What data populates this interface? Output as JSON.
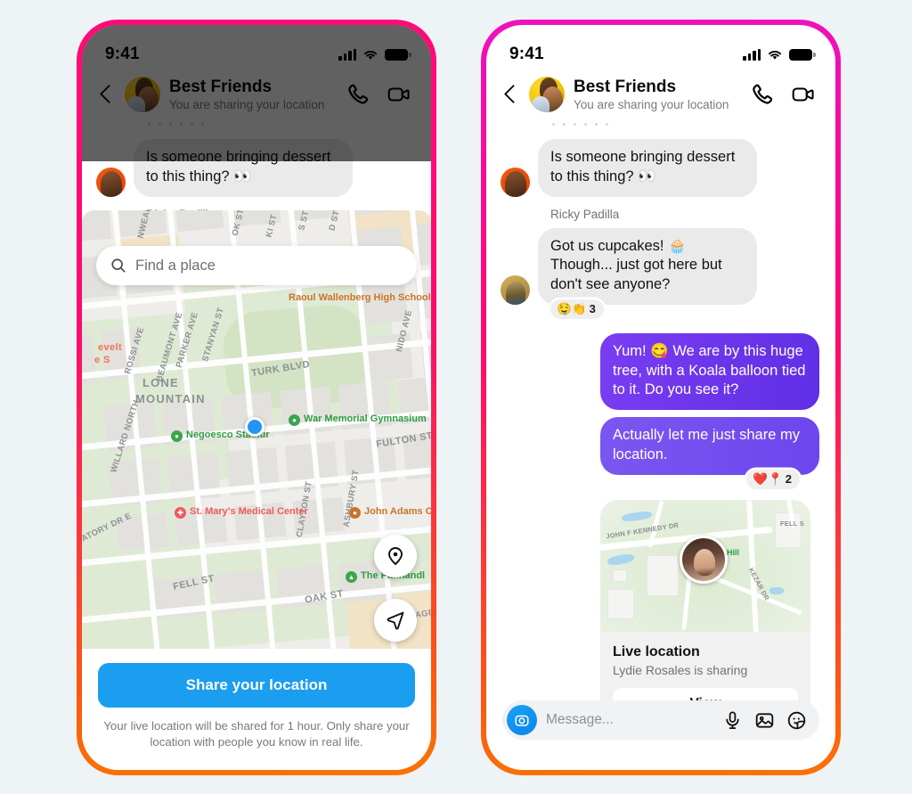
{
  "theme": {
    "background": "#eef3f6",
    "frame_gradient_top": "#ff0a78",
    "frame_gradient_bottom": "#f97306",
    "accent_blue": "#1b9df0",
    "bubble_purple": "#6b34ea",
    "bubble_grey": "#eaeaea"
  },
  "left_phone": {
    "status_bar": {
      "time": "9:41",
      "signal_icon": "cellular-bars-icon",
      "wifi_icon": "wifi-icon",
      "battery_icon": "battery-full-icon"
    },
    "header": {
      "back_icon": "back-chevron-icon",
      "avatar": "group-avatar",
      "title": "Best Friends",
      "subtitle": "You are sharing your location",
      "call_icon": "phone-icon",
      "video_icon": "video-camera-icon"
    },
    "messages": [
      {
        "sender": "",
        "text": "Is someone bringing dessert to this thing? 👀",
        "direction": "in",
        "avatar": "av-ricky"
      }
    ],
    "sender_label": "Ricky Padilla",
    "map": {
      "search_placeholder": "Find a place",
      "search_icon": "search-icon",
      "locate_icon": "location-pin-icon",
      "navigate_icon": "navigation-arrow-icon",
      "my_location_marker": "blue-dot-marker",
      "street_labels": [
        "NWEAL",
        "OK ST",
        "KI ST",
        "S ST",
        "D ST",
        "STANYAN ST",
        "BEAUMONT AVE",
        "PARKER AVE",
        "ROSSI AVE",
        "NIDO AVE",
        "TURK BLVD",
        "WILLARD NORTH",
        "FULTON ST",
        "CLAYTON ST",
        "ASHBURY ST",
        "FELL ST",
        "OAK ST",
        "NATORY DR E",
        "PAGE"
      ],
      "area_labels": [
        "LONE",
        "MOUNTAIN"
      ],
      "edge_labels": [
        "evelt",
        "e S"
      ],
      "pois": [
        {
          "name": "Raoul Wallenberg High School",
          "type": "brown"
        },
        {
          "name": "War Memorial Gymnasium",
          "type": "green"
        },
        {
          "name": "Negoesco Stadiur",
          "type": "green"
        },
        {
          "name": "St. Mary's Medical Center",
          "type": "red"
        },
        {
          "name": "John Adams Center",
          "type": "brown"
        },
        {
          "name": "The Panhandl",
          "type": "green"
        }
      ]
    },
    "share_button": "Share your location",
    "share_note": "Your live location will be shared for 1 hour. Only share your location with people you know in real life."
  },
  "right_phone": {
    "status_bar": {
      "time": "9:41",
      "signal_icon": "cellular-bars-icon",
      "wifi_icon": "wifi-icon",
      "battery_icon": "battery-full-icon"
    },
    "header": {
      "back_icon": "back-chevron-icon",
      "avatar": "group-avatar",
      "title": "Best Friends",
      "subtitle": "You are sharing your location",
      "call_icon": "phone-icon",
      "video_icon": "video-camera-icon"
    },
    "messages": [
      {
        "id": "m1",
        "direction": "in",
        "text": "Is someone bringing dessert to this thing? 👀",
        "avatar": "av-ricky"
      },
      {
        "id": "m2",
        "direction": "in",
        "sender": "Ricky Padilla",
        "text": "Got us cupcakes! 🧁 Though... just got here but don't see anyone?",
        "avatar": "av-lydie",
        "reactions": {
          "emojis": "🤤👏",
          "count": "3"
        }
      },
      {
        "id": "m3",
        "direction": "out",
        "text": "Yum! 😋 We are by this huge tree, with a Koala balloon tied to it. Do you see it?"
      },
      {
        "id": "m4",
        "direction": "out",
        "text": "Actually let me just share my location.",
        "reactions": {
          "emojis": "❤️📍",
          "count": "2"
        }
      }
    ],
    "location_card": {
      "title": "Live location",
      "subtitle": "Lydie Rosales is sharing",
      "view_button": "View",
      "map_labels": [
        "JOHN F KENNEDY DR",
        "FELL S",
        "KEZAR DR"
      ],
      "poi": "Hippie Hill",
      "avatar": "lydie-avatar-pin"
    },
    "composer": {
      "camera_icon": "camera-icon",
      "placeholder": "Message...",
      "mic_icon": "microphone-icon",
      "gallery_icon": "image-icon",
      "sticker_icon": "sticker-icon"
    }
  }
}
